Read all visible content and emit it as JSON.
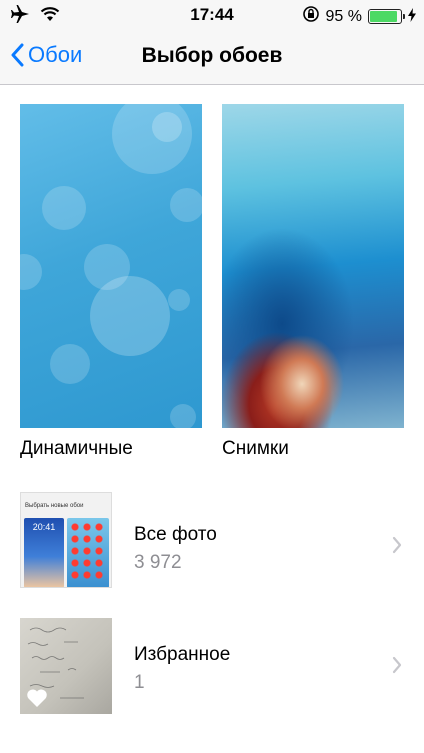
{
  "status": {
    "time": "17:44",
    "battery_text": "95 %",
    "battery_level": 0.95,
    "icons": [
      "airplane-icon",
      "wifi-icon",
      "orientation-lock-icon",
      "battery-icon",
      "charging-icon"
    ]
  },
  "nav": {
    "back_label": "Обои",
    "title": "Выбор обоев",
    "accent": "#0a7aff"
  },
  "wallpapers": [
    {
      "label": "Динамичные"
    },
    {
      "label": "Снимки"
    }
  ],
  "albums": [
    {
      "title": "Все фото",
      "count": "3 972",
      "thumb_header": "Выбрать новые обои",
      "thumb_time": "20:41"
    },
    {
      "title": "Избранное",
      "count": "1"
    }
  ]
}
